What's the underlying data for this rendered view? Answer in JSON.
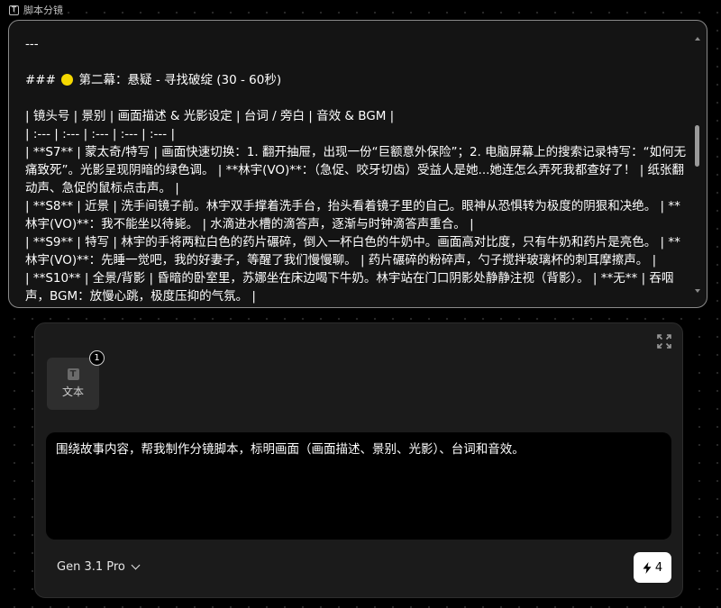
{
  "node": {
    "title": "脚本分镜",
    "icon": "text-node-icon"
  },
  "script": {
    "lines": [
      {
        "text": "---"
      },
      {
        "text": ""
      },
      {
        "prefix": "### ",
        "has_circle": true,
        "suffix": " 第二幕：悬疑 - 寻找破绽 (30 - 60秒)"
      },
      {
        "text": ""
      },
      {
        "text": "| 镜头号 | 景别 | 画面描述 & 光影设定 | 台词 / 旁白 | 音效 & BGM |"
      },
      {
        "text": "| :--- | :--- | :--- | :--- | :--- |"
      },
      {
        "text": "| **S7** | 蒙太奇/特写 | 画面快速切换：1. 翻开抽屉，出现一份“巨额意外保险”；2. 电脑屏幕上的搜索记录特写：“如何无痛致死”。光影呈现阴暗的绿色调。 | **林宇(VO)**：（急促、咬牙切齿）受益人是她...她连怎么弄死我都查好了！ | 纸张翻动声、急促的鼠标点击声。 |"
      },
      {
        "text": "| **S8** | 近景 | 洗手间镜子前。林宇双手撑着洗手台，抬头看着镜子里的自己。眼神从恐惧转为极度的阴狠和决绝。 | **林宇(VO)**：我不能坐以待毙。 | 水滴进水槽的滴答声，逐渐与时钟滴答声重合。 |"
      },
      {
        "text": "| **S9** | 特写 | 林宇的手将两粒白色的药片碾碎，倒入一杯白色的牛奶中。画面高对比度，只有牛奶和药片是亮色。 | **林宇(VO)**：先睡一觉吧，我的好妻子，等醒了我们慢慢聊。 | 药片碾碎的粉碎声，勺子搅拌玻璃杯的刺耳摩擦声。 |"
      },
      {
        "text": "| **S10** | 全景/背影 | 昏暗的卧室里，苏娜坐在床边喝下牛奶。林宇站在门口阴影处静静注视（背影）。 | **无** | 吞咽声，BGM：放慢心跳，极度压抑的气氛。 |"
      }
    ]
  },
  "generator": {
    "attachment": {
      "label": "文本",
      "count": "1"
    },
    "prompt": "围绕故事内容，帮我制作分镜脚本，标明画面（画面描述、景别、光影）、台词和音效。",
    "model": "Gen 3.1 Pro",
    "credits": "4"
  },
  "colors": {
    "background": "#000000",
    "panel": "#141414",
    "accent_circle": "#f5d800",
    "run_button": "#ffffff"
  }
}
